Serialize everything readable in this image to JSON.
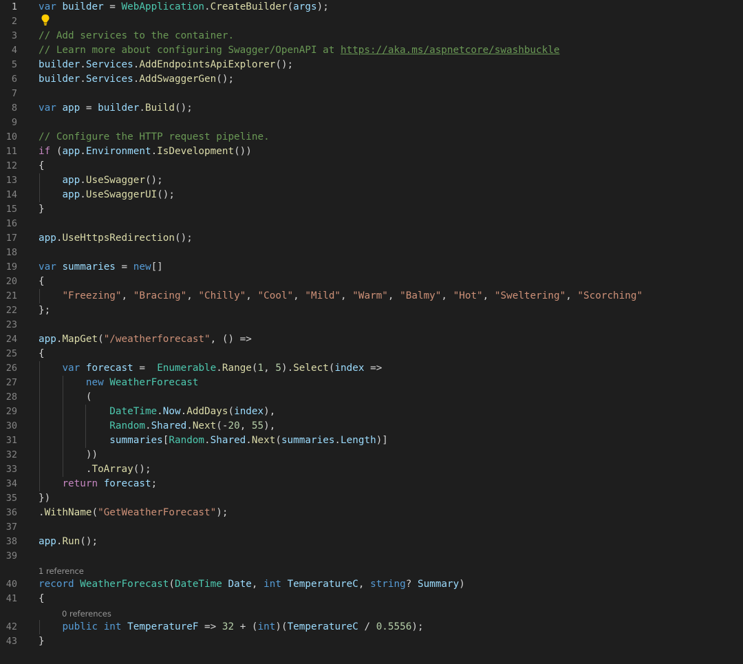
{
  "editor": {
    "language": "csharp",
    "active_line": 1,
    "colors": {
      "background": "#1e1e1e",
      "keyword": "#569cd6",
      "control": "#c586c0",
      "variable": "#9cdcfe",
      "type": "#4ec9b0",
      "function": "#dcdcaa",
      "string": "#ce9178",
      "number": "#b5cea8",
      "comment": "#6a9955",
      "line_number": "#858585"
    },
    "lightbulb_icon": "lightbulb-icon",
    "codelens": {
      "record_refs": "1 reference",
      "property_refs": "0 references"
    },
    "lines": [
      {
        "n": "1",
        "tokens": [
          [
            "kw",
            "var"
          ],
          [
            "p",
            " "
          ],
          [
            "var",
            "builder"
          ],
          [
            "p",
            " = "
          ],
          [
            "type",
            "WebApplication"
          ],
          [
            "p",
            "."
          ],
          [
            "fn",
            "CreateBuilder"
          ],
          [
            "p",
            "("
          ],
          [
            "var",
            "args"
          ],
          [
            "p",
            ");"
          ]
        ]
      },
      {
        "n": "2",
        "tokens": []
      },
      {
        "n": "3",
        "tokens": [
          [
            "cm",
            "// Add services to the container."
          ]
        ]
      },
      {
        "n": "4",
        "tokens": [
          [
            "cm",
            "// Learn more about configuring Swagger/OpenAPI at "
          ],
          [
            "link",
            "https://aka.ms/aspnetcore/swashbuckle"
          ]
        ]
      },
      {
        "n": "5",
        "tokens": [
          [
            "var",
            "builder"
          ],
          [
            "p",
            "."
          ],
          [
            "var",
            "Services"
          ],
          [
            "p",
            "."
          ],
          [
            "fn",
            "AddEndpointsApiExplorer"
          ],
          [
            "p",
            "();"
          ]
        ]
      },
      {
        "n": "6",
        "tokens": [
          [
            "var",
            "builder"
          ],
          [
            "p",
            "."
          ],
          [
            "var",
            "Services"
          ],
          [
            "p",
            "."
          ],
          [
            "fn",
            "AddSwaggerGen"
          ],
          [
            "p",
            "();"
          ]
        ]
      },
      {
        "n": "7",
        "tokens": []
      },
      {
        "n": "8",
        "tokens": [
          [
            "kw",
            "var"
          ],
          [
            "p",
            " "
          ],
          [
            "var",
            "app"
          ],
          [
            "p",
            " = "
          ],
          [
            "var",
            "builder"
          ],
          [
            "p",
            "."
          ],
          [
            "fn",
            "Build"
          ],
          [
            "p",
            "();"
          ]
        ]
      },
      {
        "n": "9",
        "tokens": []
      },
      {
        "n": "10",
        "tokens": [
          [
            "cm",
            "// Configure the HTTP request pipeline."
          ]
        ]
      },
      {
        "n": "11",
        "tokens": [
          [
            "ctl",
            "if"
          ],
          [
            "p",
            " ("
          ],
          [
            "var",
            "app"
          ],
          [
            "p",
            "."
          ],
          [
            "var",
            "Environment"
          ],
          [
            "p",
            "."
          ],
          [
            "fn",
            "IsDevelopment"
          ],
          [
            "p",
            "())"
          ]
        ]
      },
      {
        "n": "12",
        "tokens": [
          [
            "p",
            "{"
          ]
        ]
      },
      {
        "n": "13",
        "tokens": [
          [
            "p",
            "    "
          ],
          [
            "var",
            "app"
          ],
          [
            "p",
            "."
          ],
          [
            "fn",
            "UseSwagger"
          ],
          [
            "p",
            "();"
          ]
        ]
      },
      {
        "n": "14",
        "tokens": [
          [
            "p",
            "    "
          ],
          [
            "var",
            "app"
          ],
          [
            "p",
            "."
          ],
          [
            "fn",
            "UseSwaggerUI"
          ],
          [
            "p",
            "();"
          ]
        ]
      },
      {
        "n": "15",
        "tokens": [
          [
            "p",
            "}"
          ]
        ]
      },
      {
        "n": "16",
        "tokens": []
      },
      {
        "n": "17",
        "tokens": [
          [
            "var",
            "app"
          ],
          [
            "p",
            "."
          ],
          [
            "fn",
            "UseHttpsRedirection"
          ],
          [
            "p",
            "();"
          ]
        ]
      },
      {
        "n": "18",
        "tokens": []
      },
      {
        "n": "19",
        "tokens": [
          [
            "kw",
            "var"
          ],
          [
            "p",
            " "
          ],
          [
            "var",
            "summaries"
          ],
          [
            "p",
            " = "
          ],
          [
            "kw",
            "new"
          ],
          [
            "p",
            "[]"
          ]
        ]
      },
      {
        "n": "20",
        "tokens": [
          [
            "p",
            "{"
          ]
        ]
      },
      {
        "n": "21",
        "tokens": [
          [
            "p",
            "    "
          ],
          [
            "str",
            "\"Freezing\""
          ],
          [
            "p",
            ", "
          ],
          [
            "str",
            "\"Bracing\""
          ],
          [
            "p",
            ", "
          ],
          [
            "str",
            "\"Chilly\""
          ],
          [
            "p",
            ", "
          ],
          [
            "str",
            "\"Cool\""
          ],
          [
            "p",
            ", "
          ],
          [
            "str",
            "\"Mild\""
          ],
          [
            "p",
            ", "
          ],
          [
            "str",
            "\"Warm\""
          ],
          [
            "p",
            ", "
          ],
          [
            "str",
            "\"Balmy\""
          ],
          [
            "p",
            ", "
          ],
          [
            "str",
            "\"Hot\""
          ],
          [
            "p",
            ", "
          ],
          [
            "str",
            "\"Sweltering\""
          ],
          [
            "p",
            ", "
          ],
          [
            "str",
            "\"Scorching\""
          ]
        ]
      },
      {
        "n": "22",
        "tokens": [
          [
            "p",
            "};"
          ]
        ]
      },
      {
        "n": "23",
        "tokens": []
      },
      {
        "n": "24",
        "tokens": [
          [
            "var",
            "app"
          ],
          [
            "p",
            "."
          ],
          [
            "fn",
            "MapGet"
          ],
          [
            "p",
            "("
          ],
          [
            "str",
            "\"/weatherforecast\""
          ],
          [
            "p",
            ", () =>"
          ]
        ]
      },
      {
        "n": "25",
        "tokens": [
          [
            "p",
            "{"
          ]
        ]
      },
      {
        "n": "26",
        "tokens": [
          [
            "p",
            "    "
          ],
          [
            "kw",
            "var"
          ],
          [
            "p",
            " "
          ],
          [
            "var",
            "forecast"
          ],
          [
            "p",
            " =  "
          ],
          [
            "type",
            "Enumerable"
          ],
          [
            "p",
            "."
          ],
          [
            "fn",
            "Range"
          ],
          [
            "p",
            "("
          ],
          [
            "num",
            "1"
          ],
          [
            "p",
            ", "
          ],
          [
            "num",
            "5"
          ],
          [
            "p",
            ")."
          ],
          [
            "fn",
            "Select"
          ],
          [
            "p",
            "("
          ],
          [
            "var",
            "index"
          ],
          [
            "p",
            " =>"
          ]
        ]
      },
      {
        "n": "27",
        "tokens": [
          [
            "p",
            "        "
          ],
          [
            "kw",
            "new"
          ],
          [
            "p",
            " "
          ],
          [
            "type",
            "WeatherForecast"
          ]
        ]
      },
      {
        "n": "28",
        "tokens": [
          [
            "p",
            "        ("
          ]
        ]
      },
      {
        "n": "29",
        "tokens": [
          [
            "p",
            "            "
          ],
          [
            "type",
            "DateTime"
          ],
          [
            "p",
            "."
          ],
          [
            "var",
            "Now"
          ],
          [
            "p",
            "."
          ],
          [
            "fn",
            "AddDays"
          ],
          [
            "p",
            "("
          ],
          [
            "var",
            "index"
          ],
          [
            "p",
            "),"
          ]
        ]
      },
      {
        "n": "30",
        "tokens": [
          [
            "p",
            "            "
          ],
          [
            "type",
            "Random"
          ],
          [
            "p",
            "."
          ],
          [
            "var",
            "Shared"
          ],
          [
            "p",
            "."
          ],
          [
            "fn",
            "Next"
          ],
          [
            "p",
            "(-"
          ],
          [
            "num",
            "20"
          ],
          [
            "p",
            ", "
          ],
          [
            "num",
            "55"
          ],
          [
            "p",
            "),"
          ]
        ]
      },
      {
        "n": "31",
        "tokens": [
          [
            "p",
            "            "
          ],
          [
            "var",
            "summaries"
          ],
          [
            "p",
            "["
          ],
          [
            "type",
            "Random"
          ],
          [
            "p",
            "."
          ],
          [
            "var",
            "Shared"
          ],
          [
            "p",
            "."
          ],
          [
            "fn",
            "Next"
          ],
          [
            "p",
            "("
          ],
          [
            "var",
            "summaries"
          ],
          [
            "p",
            "."
          ],
          [
            "var",
            "Length"
          ],
          [
            "p",
            ")]"
          ]
        ]
      },
      {
        "n": "32",
        "tokens": [
          [
            "p",
            "        ))"
          ]
        ]
      },
      {
        "n": "33",
        "tokens": [
          [
            "p",
            "        ."
          ],
          [
            "fn",
            "ToArray"
          ],
          [
            "p",
            "();"
          ]
        ]
      },
      {
        "n": "34",
        "tokens": [
          [
            "p",
            "    "
          ],
          [
            "ctl",
            "return"
          ],
          [
            "p",
            " "
          ],
          [
            "var",
            "forecast"
          ],
          [
            "p",
            ";"
          ]
        ]
      },
      {
        "n": "35",
        "tokens": [
          [
            "p",
            "})"
          ]
        ]
      },
      {
        "n": "36",
        "tokens": [
          [
            "p",
            "."
          ],
          [
            "fn",
            "WithName"
          ],
          [
            "p",
            "("
          ],
          [
            "str",
            "\"GetWeatherForecast\""
          ],
          [
            "p",
            ");"
          ]
        ]
      },
      {
        "n": "37",
        "tokens": []
      },
      {
        "n": "38",
        "tokens": [
          [
            "var",
            "app"
          ],
          [
            "p",
            "."
          ],
          [
            "fn",
            "Run"
          ],
          [
            "p",
            "();"
          ]
        ]
      },
      {
        "n": "39",
        "tokens": []
      },
      {
        "n": "40",
        "tokens": [
          [
            "kw",
            "record"
          ],
          [
            "p",
            " "
          ],
          [
            "type",
            "WeatherForecast"
          ],
          [
            "p",
            "("
          ],
          [
            "type",
            "DateTime"
          ],
          [
            "p",
            " "
          ],
          [
            "var",
            "Date"
          ],
          [
            "p",
            ", "
          ],
          [
            "kw",
            "int"
          ],
          [
            "p",
            " "
          ],
          [
            "var",
            "TemperatureC"
          ],
          [
            "p",
            ", "
          ],
          [
            "kw",
            "string"
          ],
          [
            "p",
            "? "
          ],
          [
            "var",
            "Summary"
          ],
          [
            "p",
            ")"
          ]
        ]
      },
      {
        "n": "41",
        "tokens": [
          [
            "p",
            "{"
          ]
        ]
      },
      {
        "n": "42",
        "tokens": [
          [
            "p",
            "    "
          ],
          [
            "kw",
            "public"
          ],
          [
            "p",
            " "
          ],
          [
            "kw",
            "int"
          ],
          [
            "p",
            " "
          ],
          [
            "var",
            "TemperatureF"
          ],
          [
            "p",
            " => "
          ],
          [
            "num",
            "32"
          ],
          [
            "p",
            " + ("
          ],
          [
            "kw",
            "int"
          ],
          [
            "p",
            ")("
          ],
          [
            "var",
            "TemperatureC"
          ],
          [
            "p",
            " / "
          ],
          [
            "num",
            "0.5556"
          ],
          [
            "p",
            ");"
          ]
        ]
      },
      {
        "n": "43",
        "tokens": [
          [
            "p",
            "}"
          ]
        ]
      }
    ]
  }
}
